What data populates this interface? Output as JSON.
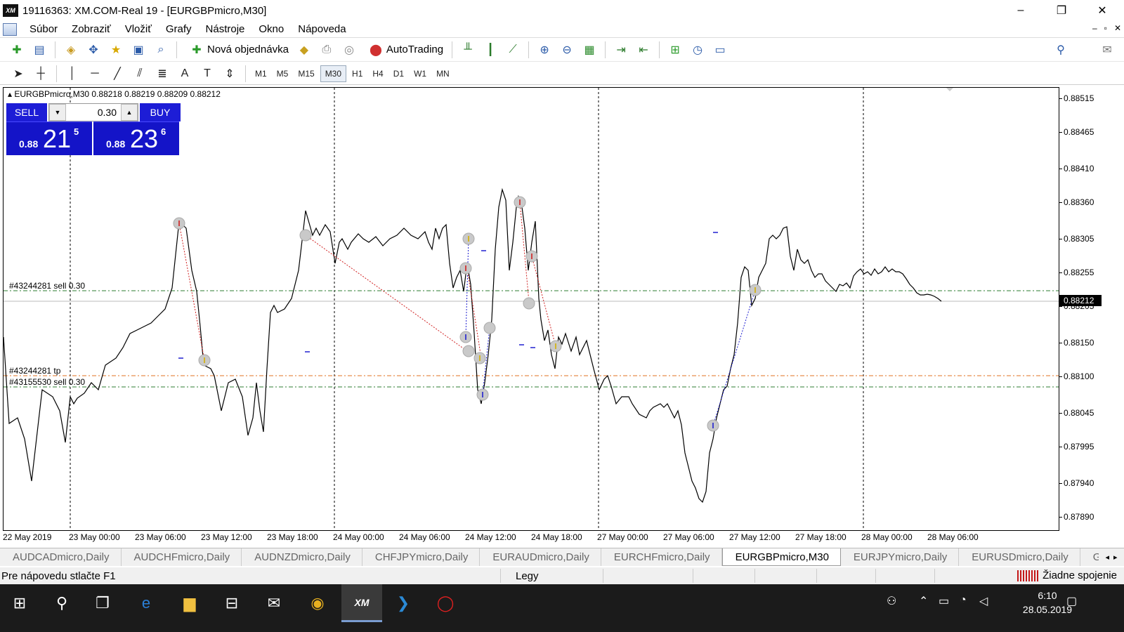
{
  "window": {
    "title": "19116363: XM.COM-Real 19 - [EURGBPmicro,M30]",
    "logo_text": "XM",
    "minimize": "–",
    "maximize": "❐",
    "close": "✕"
  },
  "menu": {
    "items": [
      "Súbor",
      "Zobraziť",
      "Vložiť",
      "Grafy",
      "Nástroje",
      "Okno",
      "Nápoveda"
    ],
    "mdi_minimize": "–",
    "mdi_restore": "▫",
    "mdi_close": "✕"
  },
  "toolbar": {
    "new_order_label": "Nová objednávka",
    "autotrading_label": "AutoTrading"
  },
  "timeframes": {
    "items": [
      "M1",
      "M5",
      "M15",
      "M30",
      "H1",
      "H4",
      "D1",
      "W1",
      "MN"
    ],
    "active": "M30"
  },
  "chart": {
    "symbol_info": "EURGBPmicro,M30  0.88218 0.88219 0.88209 0.88212",
    "current_price": "0.88212",
    "order_labels": {
      "sell_order_1": "#43244281 sell 0.30",
      "tp_order": "#43244281 tp",
      "sell_order_2": "#43155530 sell 0.30"
    }
  },
  "trade_panel": {
    "sell_label": "SELL",
    "buy_label": "BUY",
    "lot_value": "0.30",
    "sell_small": "0.88",
    "sell_big": "21",
    "sell_sup": "5",
    "buy_small": "0.88",
    "buy_big": "23",
    "buy_sup": "6"
  },
  "price_axis": [
    "0.88515",
    "0.88465",
    "0.88410",
    "0.88360",
    "0.88305",
    "0.88255",
    "0.88205",
    "0.88150",
    "0.88100",
    "0.88045",
    "0.87995",
    "0.87940",
    "0.87890"
  ],
  "time_axis": [
    "22 May 2019",
    "23 May 00:00",
    "23 May 06:00",
    "23 May 12:00",
    "23 May 18:00",
    "24 May 00:00",
    "24 May 06:00",
    "24 May 12:00",
    "24 May 18:00",
    "27 May 00:00",
    "27 May 06:00",
    "27 May 12:00",
    "27 May 18:00",
    "28 May 00:00",
    "28 May 06:00"
  ],
  "tabs": {
    "items": [
      "AUDCADmicro,Daily",
      "AUDCHFmicro,Daily",
      "AUDNZDmicro,Daily",
      "CHFJPYmicro,Daily",
      "EURAUDmicro,Daily",
      "EURCHFmicro,Daily",
      "EURGBPmicro,M30",
      "EURJPYmicro,Daily",
      "EURUSDmicro,Daily",
      "GBPAUDmicro,D"
    ],
    "active": "EURGBPmicro,M30",
    "scroll_left": "◂",
    "scroll_right": "▸"
  },
  "status": {
    "help": "Pre nápovedu stlačte F1",
    "profile": "Legy",
    "connection": "Žiadne spojenie"
  },
  "taskbar": {
    "active_app_label": "XM",
    "time": "6:10",
    "date": "28.05.2019"
  },
  "colors": {
    "sell_blue": "#1d1dd6",
    "quote_blue": "#1414c8",
    "sell_level": "#2e7d32",
    "tp_level": "#e07020",
    "trade_line_sell": "#d02020",
    "trade_line_buy": "#2020d0"
  }
}
